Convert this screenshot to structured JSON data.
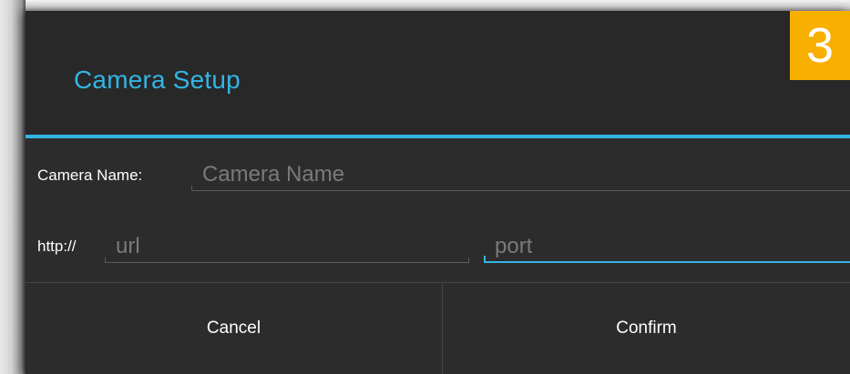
{
  "dialog": {
    "title": "Camera Setup",
    "step_badge": "3",
    "camera_name": {
      "label": "Camera Name:",
      "value": "",
      "placeholder": "Camera Name"
    },
    "url_row": {
      "prefix": "http://",
      "url": {
        "value": "",
        "placeholder": "url"
      },
      "port": {
        "value": "",
        "placeholder": "port",
        "focused": true
      }
    },
    "buttons": {
      "cancel": "Cancel",
      "confirm": "Confirm"
    }
  },
  "colors": {
    "accent": "#33b5e5",
    "badge": "#f8b000",
    "dialog_bg": "#2c2c2c",
    "hint_text": "#7a7a7a"
  }
}
